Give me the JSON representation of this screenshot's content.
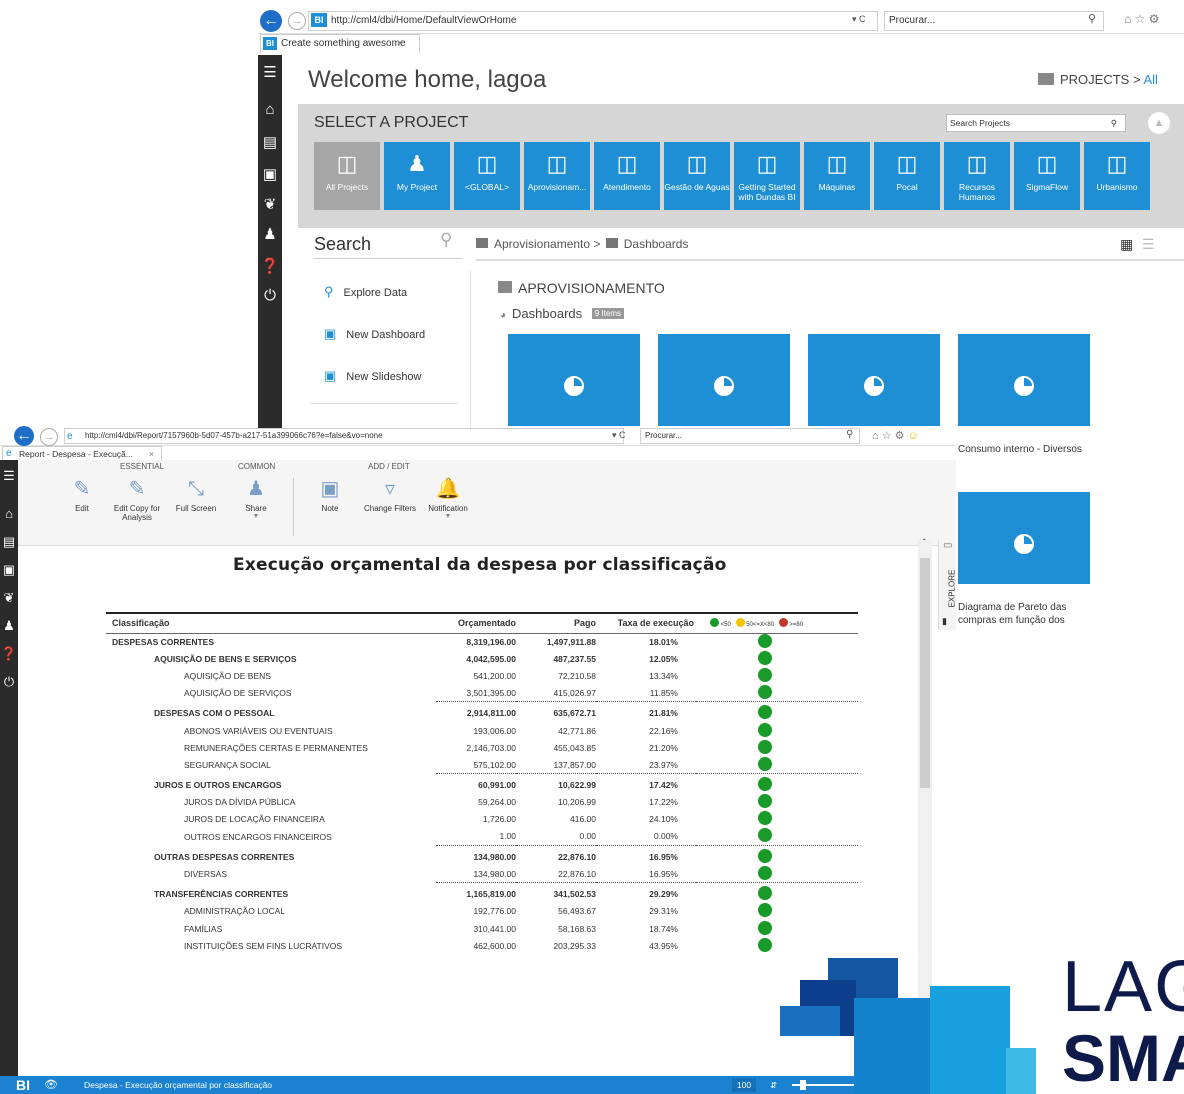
{
  "back_window": {
    "url": "http://cml4/dbi/Home/DefaultViewOrHome",
    "url_bold_host": "cml4",
    "search_placeholder": "Procurar...",
    "tab_title": "Create something awesome",
    "welcome": "Welcome home, lagoa",
    "projects_crumb": "PROJECTS > ",
    "projects_crumb_link": "All",
    "select_project": "SELECT A PROJECT",
    "search_projects_placeholder": "Search Projects",
    "projects": [
      {
        "label": "All Projects",
        "selected": true,
        "icon": "stack-icon"
      },
      {
        "label": "My Project",
        "icon": "user-icon"
      },
      {
        "label": "<GLOBAL>",
        "icon": "stack-icon"
      },
      {
        "label": "Aprovisionam...",
        "icon": "stack-icon"
      },
      {
        "label": "Atendimento",
        "icon": "stack-icon"
      },
      {
        "label": "Gestão de Aguas",
        "icon": "stack-icon"
      },
      {
        "label": "Getting Started with Dundas BI",
        "icon": "stack-icon"
      },
      {
        "label": "Máquinas",
        "icon": "stack-icon"
      },
      {
        "label": "Pocal",
        "icon": "stack-icon"
      },
      {
        "label": "Recursos Humanos",
        "icon": "stack-icon"
      },
      {
        "label": "SigmaFlow",
        "icon": "stack-icon"
      },
      {
        "label": "Urbanismo",
        "icon": "stack-icon"
      }
    ],
    "search_label": "Search",
    "breadcrumb_project": "Aprovisionamento > ",
    "breadcrumb_folder": "Dashboards",
    "actions": [
      "Explore Data",
      "New Dashboard",
      "New Slideshow"
    ],
    "section_title": "APROVISIONAMENTO",
    "dashboards_label": "Dashboards",
    "dashboards_badge": "9 Items",
    "tile_caption_1": "Consumo interno - Diversos",
    "tile_caption_2": "Diagrama de Pareto das compras em função dos"
  },
  "front_window": {
    "url": "http://cml4/dbi/Report/7157960b-5d07-457b-a217-51a399066c76?e=false&vo=none",
    "search_placeholder": "Procurar...",
    "tab_title": "Report - Despesa - Execuçã...",
    "ribbon_groups": [
      "ESSENTIAL",
      "COMMON",
      "ADD / EDIT"
    ],
    "ribbon_buttons": [
      {
        "label": "Edit",
        "icon": "edit-icon"
      },
      {
        "label": "Edit Copy for Analysis",
        "icon": "edit-copy-icon"
      },
      {
        "label": "Full Screen",
        "icon": "fullscreen-icon"
      },
      {
        "label": "Share",
        "icon": "share-icon"
      },
      {
        "label": "Note",
        "icon": "note-icon"
      },
      {
        "label": "Change Filters",
        "icon": "filter-icon"
      },
      {
        "label": "Notification",
        "icon": "bell-icon"
      }
    ],
    "explore_label": "EXPLORE",
    "report_title": "Execução orçamental da despesa por classificação",
    "columns": [
      "Classificação",
      "Orçamentado",
      "Pago",
      "Taxa de execução"
    ],
    "legend": [
      {
        "label": "<50",
        "color": "#1a9a2a"
      },
      {
        "label": "50<=X<80",
        "color": "#f5c400"
      },
      {
        "label": ">=80",
        "color": "#c0392b"
      }
    ],
    "rows": [
      {
        "name": "DESPESAS CORRENTES",
        "level": 0,
        "orc": "8,319,196.00",
        "pago": "1,497,911.88",
        "taxa": "18.01%",
        "bold": true
      },
      {
        "name": "AQUISIÇÃO DE BENS E SERVIÇOS",
        "level": 1,
        "orc": "4,042,595.00",
        "pago": "487,237.55",
        "taxa": "12.05%",
        "bold": true
      },
      {
        "name": "AQUISIÇÃO DE BENS",
        "level": 2,
        "orc": "541,200.00",
        "pago": "72,210.58",
        "taxa": "13.34%"
      },
      {
        "name": "AQUISIÇÃO DE SERVIÇOS",
        "level": 2,
        "orc": "3,501,395.00",
        "pago": "415,026.97",
        "taxa": "11.85%"
      },
      {
        "sep": true
      },
      {
        "name": "DESPESAS COM O PESSOAL",
        "level": 1,
        "orc": "2,914,811.00",
        "pago": "635,672.71",
        "taxa": "21.81%",
        "bold": true
      },
      {
        "name": "ABONOS VARIÁVEIS OU EVENTUAIS",
        "level": 2,
        "orc": "193,006.00",
        "pago": "42,771.86",
        "taxa": "22.16%"
      },
      {
        "name": "REMUNERAÇÕES CERTAS E PERMANENTES",
        "level": 2,
        "orc": "2,146,703.00",
        "pago": "455,043.85",
        "taxa": "21.20%"
      },
      {
        "name": "SEGURANÇA SOCIAL",
        "level": 2,
        "orc": "575,102.00",
        "pago": "137,857.00",
        "taxa": "23.97%"
      },
      {
        "sep": true
      },
      {
        "name": "JUROS E OUTROS ENCARGOS",
        "level": 1,
        "orc": "60,991.00",
        "pago": "10,622.99",
        "taxa": "17.42%",
        "bold": true
      },
      {
        "name": "JUROS DA DÍVIDA PÚBLICA",
        "level": 2,
        "orc": "59,264.00",
        "pago": "10,206.99",
        "taxa": "17.22%"
      },
      {
        "name": "JUROS DE LOCAÇÃO FINANCEIRA",
        "level": 2,
        "orc": "1,726.00",
        "pago": "416.00",
        "taxa": "24.10%"
      },
      {
        "name": "OUTROS ENCARGOS FINANCEIROS",
        "level": 2,
        "orc": "1.00",
        "pago": "0.00",
        "taxa": "0.00%"
      },
      {
        "sep": true
      },
      {
        "name": "OUTRAS DESPESAS CORRENTES",
        "level": 1,
        "orc": "134,980.00",
        "pago": "22,876.10",
        "taxa": "16.95%",
        "bold": true
      },
      {
        "name": "DIVERSAS",
        "level": 2,
        "orc": "134,980.00",
        "pago": "22,876.10",
        "taxa": "16.95%"
      },
      {
        "sep": true
      },
      {
        "name": "TRANSFERÊNCIAS CORRENTES",
        "level": 1,
        "orc": "1,165,819.00",
        "pago": "341,502.53",
        "taxa": "29.29%",
        "bold": true
      },
      {
        "name": "ADMINISTRAÇÃO LOCAL",
        "level": 2,
        "orc": "192,776.00",
        "pago": "56,493.67",
        "taxa": "29.31%"
      },
      {
        "name": "FAMÍLIAS",
        "level": 2,
        "orc": "310,441.00",
        "pago": "58,168.63",
        "taxa": "18.74%"
      },
      {
        "name": "INSTITUIÇÕES SEM FINS LUCRATIVOS",
        "level": 2,
        "orc": "462,600.00",
        "pago": "203,295.33",
        "taxa": "43.95%"
      }
    ],
    "status_title": "Despesa - Execução orçamental por classificação",
    "zoom": "100"
  },
  "logo": {
    "line1": "LAG",
    "line2": "SMA"
  },
  "colors": {
    "accent": "#1e8fd4",
    "status_green": "#1a9a2a",
    "nav_bg": "#2b2b2b",
    "logo_navy": "#0d1a4a"
  }
}
